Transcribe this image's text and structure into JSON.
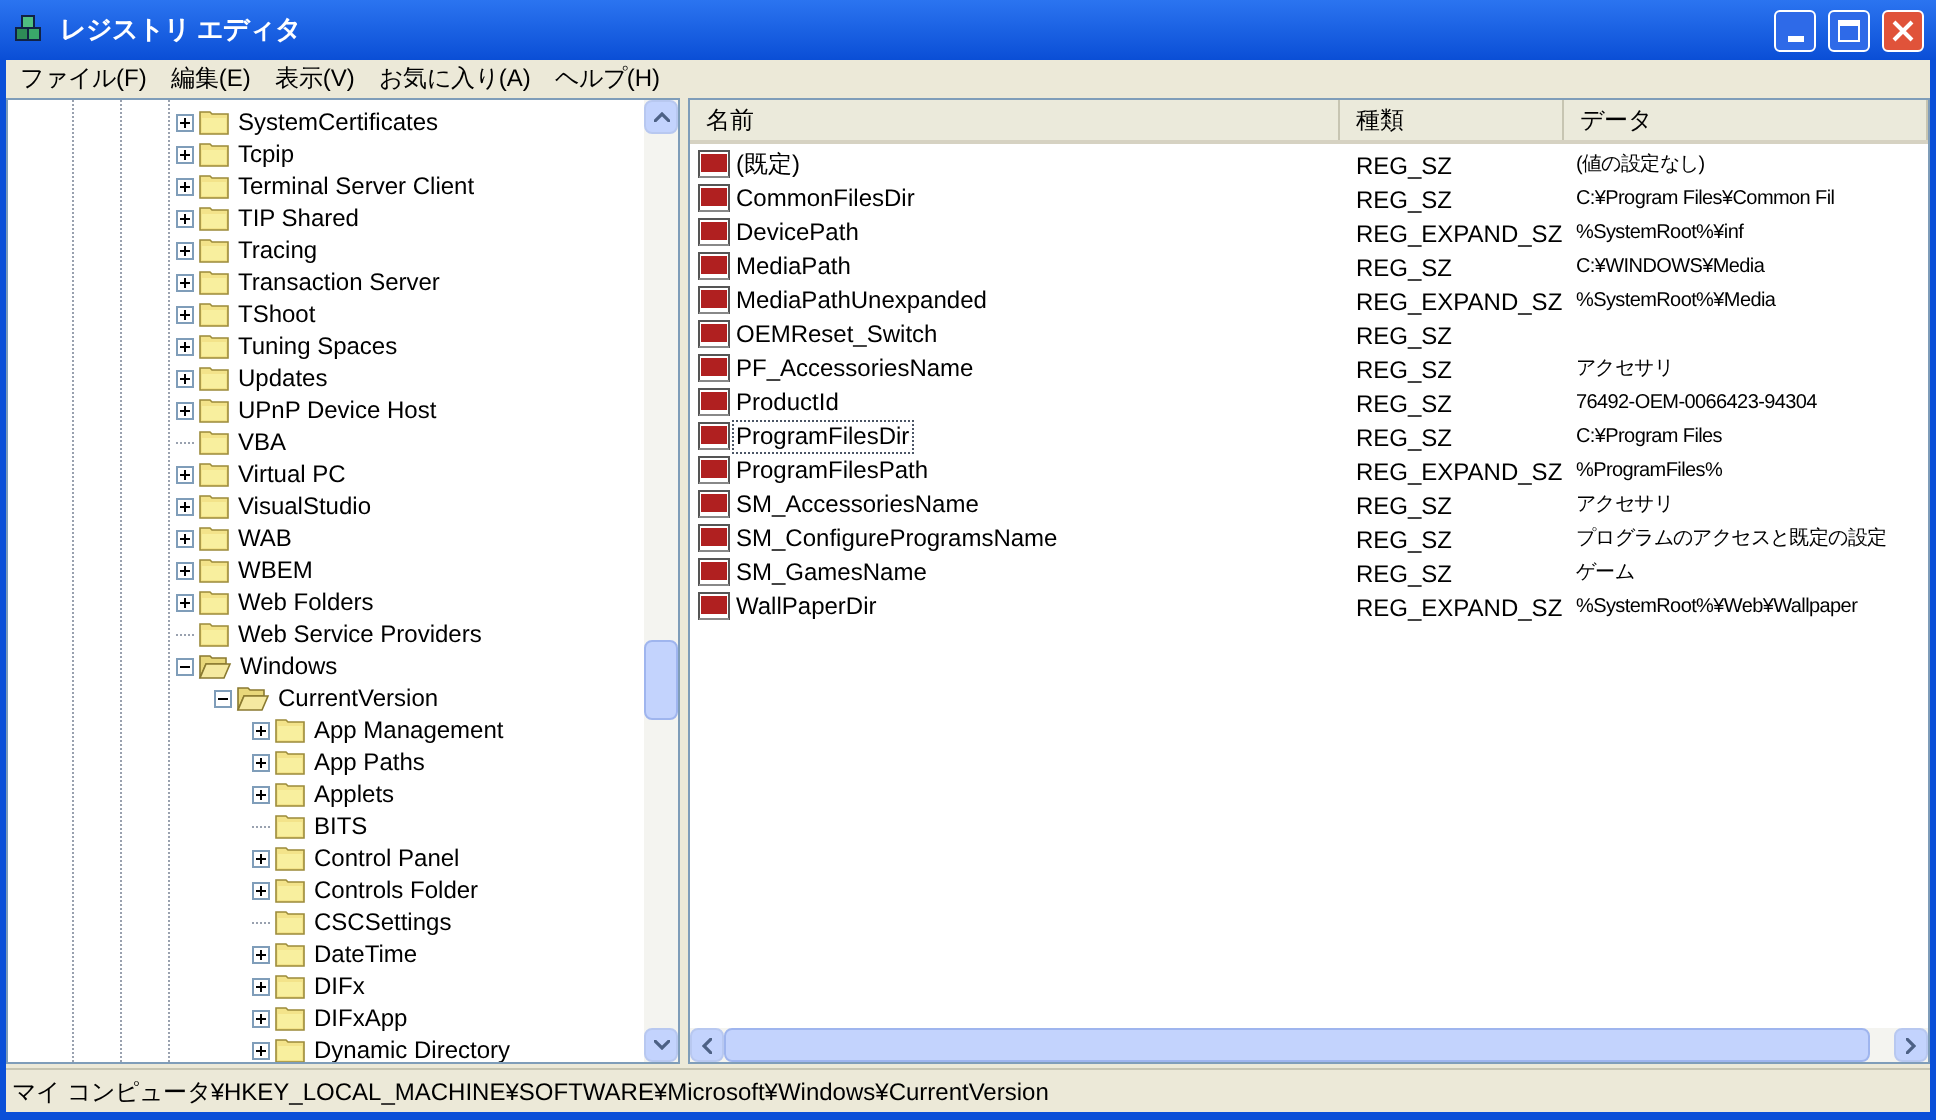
{
  "window": {
    "title": "レジストリ エディタ"
  },
  "menu": [
    "ファイル(F)",
    "編集(E)",
    "表示(V)",
    "お気に入り(A)",
    "ヘルプ(H)"
  ],
  "tree": [
    {
      "label": "SystemCertificates",
      "has_children": true,
      "expanded": false
    },
    {
      "label": "Tcpip",
      "has_children": true,
      "expanded": false
    },
    {
      "label": "Terminal Server Client",
      "has_children": true,
      "expanded": false
    },
    {
      "label": "TIP Shared",
      "has_children": true,
      "expanded": false
    },
    {
      "label": "Tracing",
      "has_children": true,
      "expanded": false
    },
    {
      "label": "Transaction Server",
      "has_children": true,
      "expanded": false
    },
    {
      "label": "TShoot",
      "has_children": true,
      "expanded": false
    },
    {
      "label": "Tuning Spaces",
      "has_children": true,
      "expanded": false
    },
    {
      "label": "Updates",
      "has_children": true,
      "expanded": false
    },
    {
      "label": "UPnP Device Host",
      "has_children": true,
      "expanded": false
    },
    {
      "label": "VBA",
      "has_children": false,
      "expanded": false
    },
    {
      "label": "Virtual PC",
      "has_children": true,
      "expanded": false
    },
    {
      "label": "VisualStudio",
      "has_children": true,
      "expanded": false
    },
    {
      "label": "WAB",
      "has_children": true,
      "expanded": false
    },
    {
      "label": "WBEM",
      "has_children": true,
      "expanded": false
    },
    {
      "label": "Web Folders",
      "has_children": true,
      "expanded": false
    },
    {
      "label": "Web Service Providers",
      "has_children": false,
      "expanded": false
    },
    {
      "label": "Windows",
      "has_children": true,
      "expanded": true,
      "children": [
        {
          "label": "CurrentVersion",
          "has_children": true,
          "expanded": true,
          "children": [
            {
              "label": "App Management",
              "has_children": true,
              "expanded": false
            },
            {
              "label": "App Paths",
              "has_children": true,
              "expanded": false
            },
            {
              "label": "Applets",
              "has_children": true,
              "expanded": false
            },
            {
              "label": "BITS",
              "has_children": false,
              "expanded": false
            },
            {
              "label": "Control Panel",
              "has_children": true,
              "expanded": false
            },
            {
              "label": "Controls Folder",
              "has_children": true,
              "expanded": false
            },
            {
              "label": "CSCSettings",
              "has_children": false,
              "expanded": false
            },
            {
              "label": "DateTime",
              "has_children": true,
              "expanded": false
            },
            {
              "label": "DIFx",
              "has_children": true,
              "expanded": false
            },
            {
              "label": "DIFxApp",
              "has_children": true,
              "expanded": false
            },
            {
              "label": "Dynamic Directory",
              "has_children": true,
              "expanded": false
            }
          ]
        }
      ]
    }
  ],
  "list": {
    "columns": [
      "名前",
      "種類",
      "データ"
    ],
    "rows": [
      {
        "name": "(既定)",
        "type": "REG_SZ",
        "data": "(値の設定なし)",
        "focused": false
      },
      {
        "name": "CommonFilesDir",
        "type": "REG_SZ",
        "data": "C:¥Program Files¥Common Fil",
        "focused": false
      },
      {
        "name": "DevicePath",
        "type": "REG_EXPAND_SZ",
        "data": "%SystemRoot%¥inf",
        "focused": false
      },
      {
        "name": "MediaPath",
        "type": "REG_SZ",
        "data": "C:¥WINDOWS¥Media",
        "focused": false
      },
      {
        "name": "MediaPathUnexpanded",
        "type": "REG_EXPAND_SZ",
        "data": "%SystemRoot%¥Media",
        "focused": false
      },
      {
        "name": "OEMReset_Switch",
        "type": "REG_SZ",
        "focused": false
      },
      {
        "name": "PF_AccessoriesName",
        "type": "REG_SZ",
        "data": "アクセサリ",
        "focused": false
      },
      {
        "name": "ProductId",
        "type": "REG_SZ",
        "data": "76492-OEM-0066423-94304",
        "focused": false
      },
      {
        "name": "ProgramFilesDir",
        "type": "REG_SZ",
        "data": "C:¥Program Files",
        "focused": true
      },
      {
        "name": "ProgramFilesPath",
        "type": "REG_EXPAND_SZ",
        "data": "%ProgramFiles%",
        "focused": false
      },
      {
        "name": "SM_AccessoriesName",
        "type": "REG_SZ",
        "data": "アクセサリ",
        "focused": false
      },
      {
        "name": "SM_ConfigureProgramsName",
        "type": "REG_SZ",
        "data": "プログラムのアクセスと既定の設定",
        "focused": false
      },
      {
        "name": "SM_GamesName",
        "type": "REG_SZ",
        "data": "ゲーム",
        "focused": false
      },
      {
        "name": "WallPaperDir",
        "type": "REG_EXPAND_SZ",
        "data": "%SystemRoot%¥Web¥Wallpaper",
        "focused": false
      }
    ]
  },
  "status_bar": "マイ コンピュータ¥HKEY_LOCAL_MACHINE¥SOFTWARE¥Microsoft¥Windows¥CurrentVersion"
}
